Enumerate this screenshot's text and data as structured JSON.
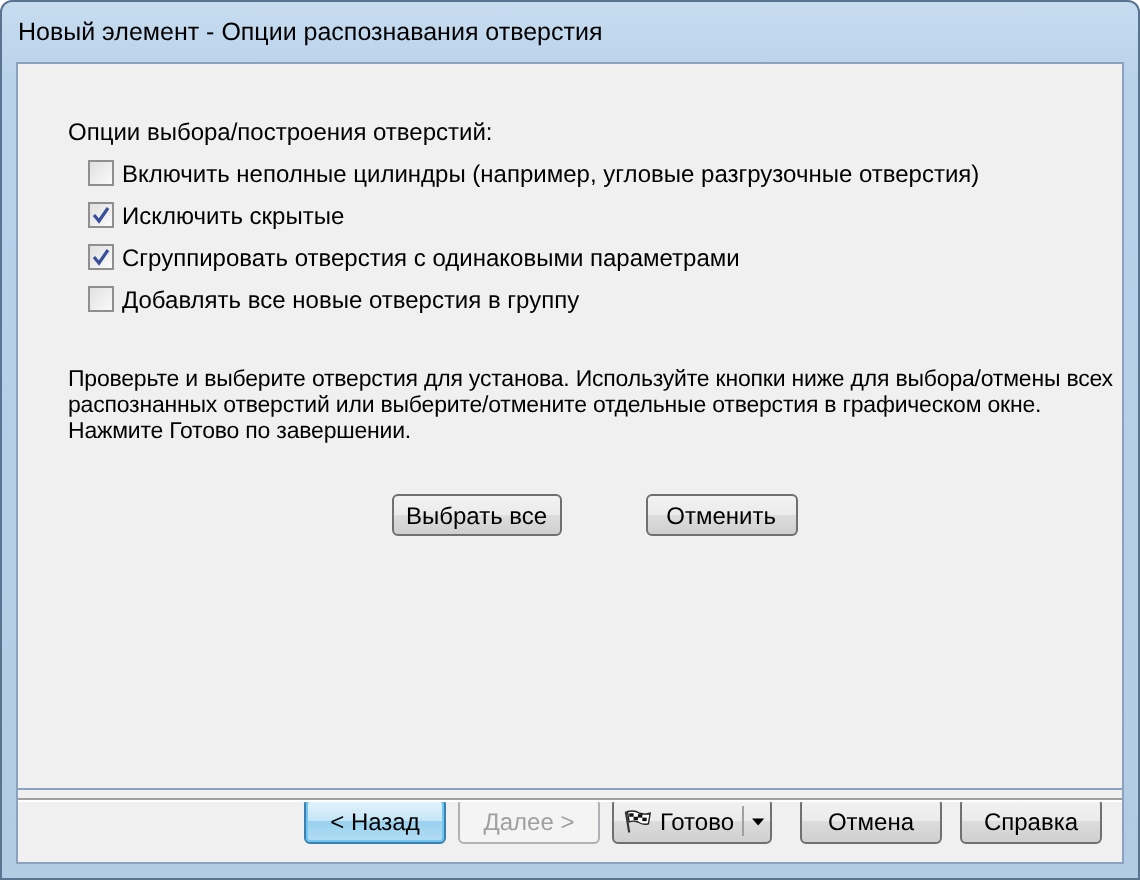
{
  "window": {
    "title": "Новый элемент - Опции распознавания отверстия"
  },
  "options": {
    "heading": "Опции выбора/построения отверстий:",
    "items": [
      {
        "label": "Включить неполные цилиндры (например, угловые разгрузочные отверстия)",
        "checked": false
      },
      {
        "label": "Исключить скрытые",
        "checked": true
      },
      {
        "label": "Сгруппировать отверстия с одинаковыми параметрами",
        "checked": true
      },
      {
        "label": "Добавлять все новые отверстия в группу",
        "checked": false
      }
    ]
  },
  "instructions": [
    "Проверьте и выберите отверстия для установа. Используйте кнопки ниже для выбора/отмены всех",
    "распознанных отверстий или выберите/отмените отдельные отверстия в графическом окне.",
    "Нажмите Готово по завершении."
  ],
  "selection_buttons": [
    "Выбрать все",
    "Отменить"
  ],
  "footer_buttons": [
    {
      "label": "< Назад",
      "kind": "plain",
      "disabled": false,
      "focused": true
    },
    {
      "label": "Далее >",
      "kind": "plain",
      "disabled": true,
      "focused": false
    },
    {
      "label": "Готово",
      "kind": "split",
      "disabled": false,
      "focused": false
    },
    {
      "label": "Отмена",
      "kind": "plain",
      "disabled": false,
      "focused": false
    },
    {
      "label": "Справка",
      "kind": "plain",
      "disabled": false,
      "focused": false
    }
  ]
}
